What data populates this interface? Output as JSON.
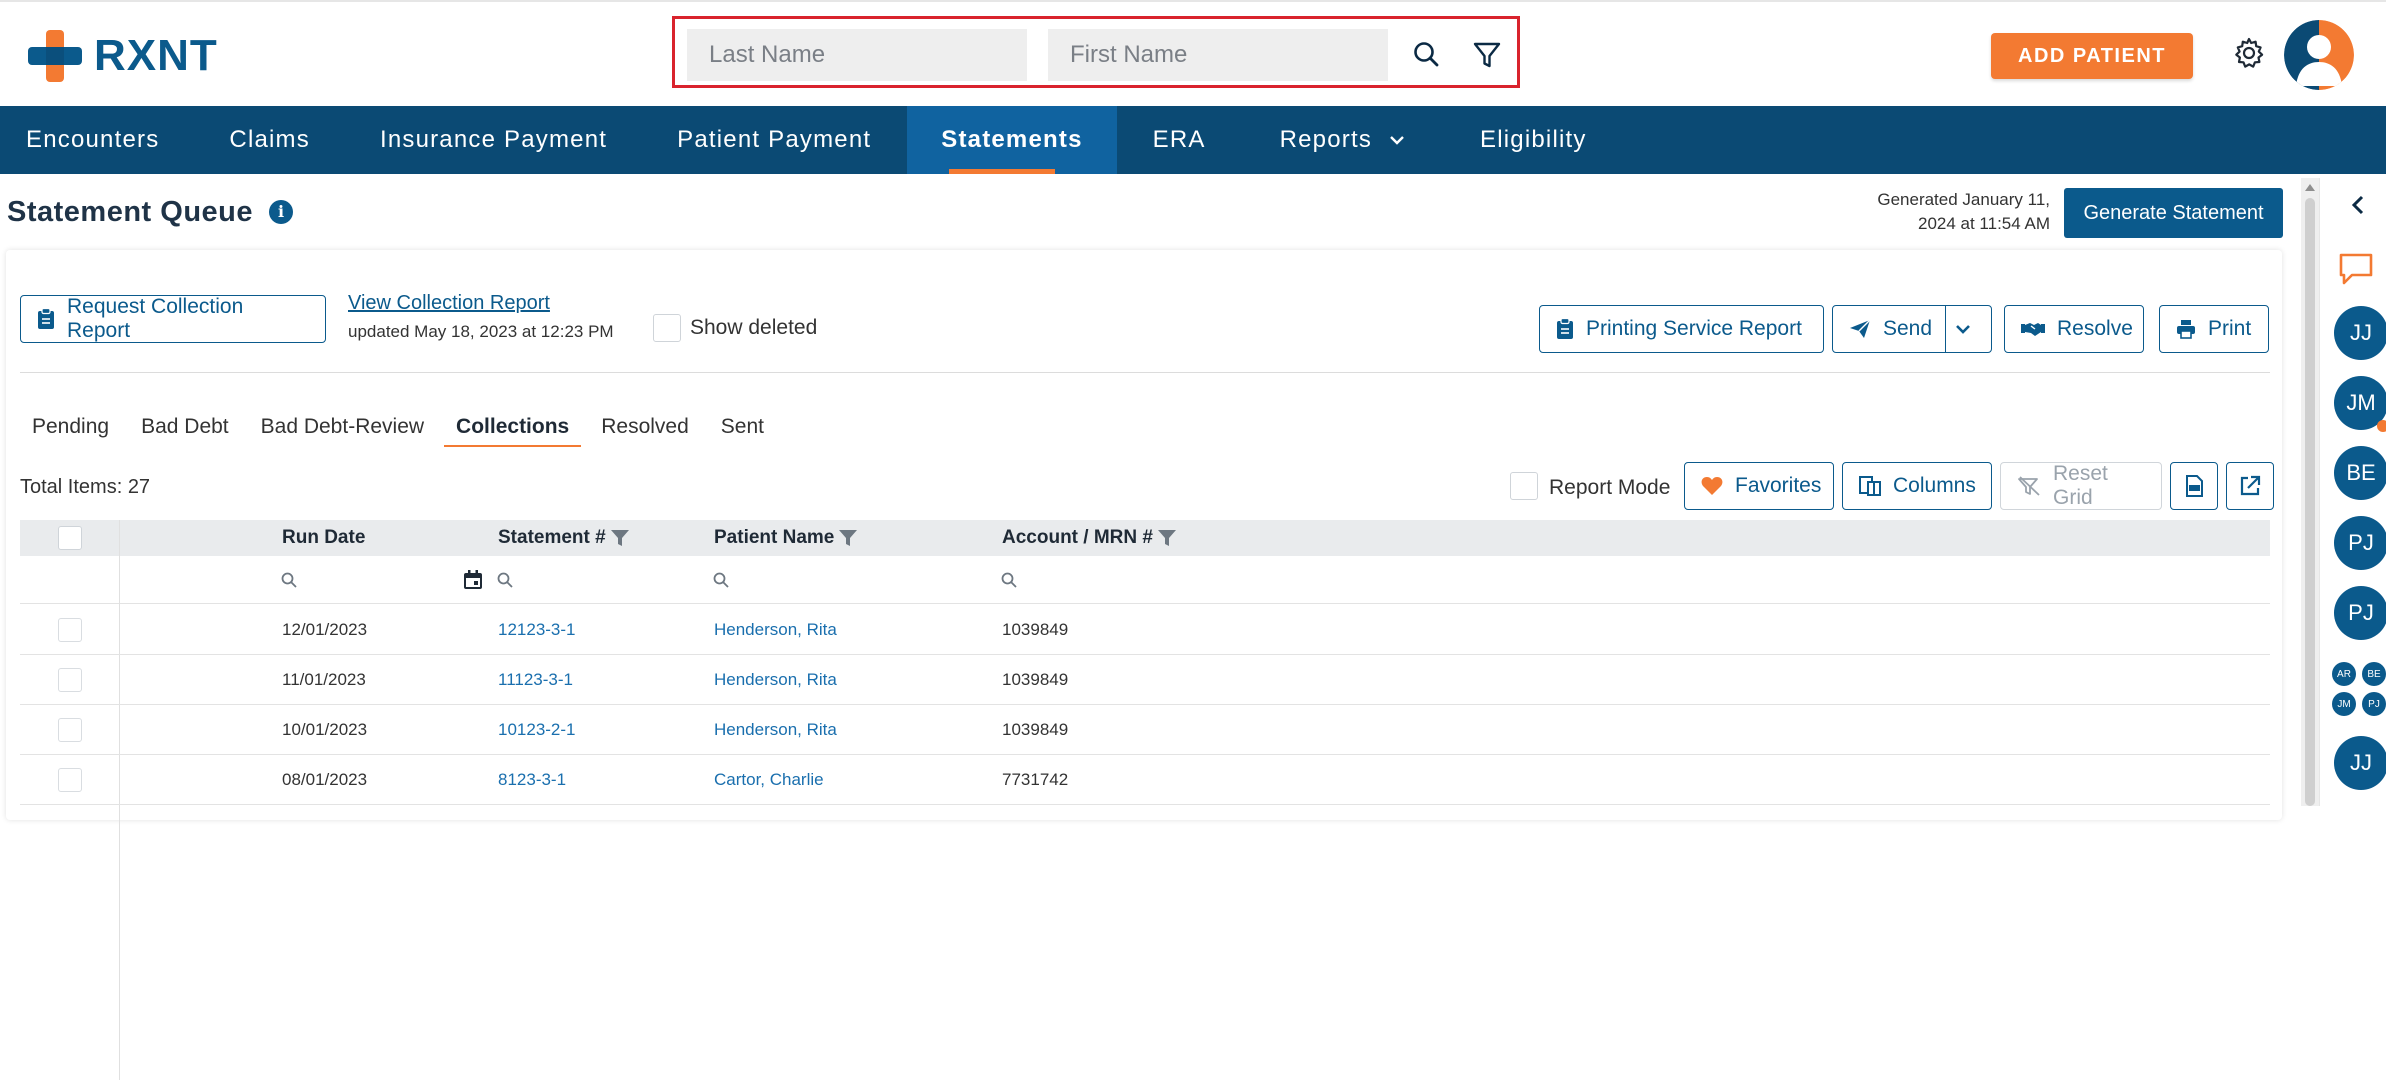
{
  "brand": {
    "name": "RXNT",
    "orange": "#f37a32",
    "navy": "#0b4a74",
    "blue": "#0b5a8c",
    "highlight_border": "#d9232d"
  },
  "header": {
    "search": {
      "last_name_placeholder": "Last Name",
      "first_name_placeholder": "First Name",
      "search_icon": "search-icon",
      "filter_icon": "filter-icon"
    },
    "add_patient_label": "ADD PATIENT",
    "settings_icon": "gear-icon",
    "avatar_icon": "user-avatar-icon"
  },
  "nav": {
    "items": [
      {
        "label": "Encounters"
      },
      {
        "label": "Claims"
      },
      {
        "label": "Insurance Payment"
      },
      {
        "label": "Patient Payment"
      },
      {
        "label": "Statements",
        "active": true
      },
      {
        "label": "ERA"
      },
      {
        "label": "Reports",
        "has_dropdown": true
      },
      {
        "label": "Eligibility"
      }
    ]
  },
  "page": {
    "title": "Statement Queue",
    "info_icon": "info-icon",
    "generated_text": "Generated January 11, 2024 at 11:54 AM",
    "generate_button": "Generate Statement"
  },
  "toolbar": {
    "request_collection_report": "Request Collection Report",
    "view_collection_report": "View Collection Report",
    "updated_text": "updated May 18, 2023 at 12:23 PM",
    "show_deleted": "Show deleted",
    "printing_service_report": "Printing Service Report",
    "send": "Send",
    "resolve": "Resolve",
    "print": "Print"
  },
  "tabs": [
    {
      "label": "Pending"
    },
    {
      "label": "Bad Debt"
    },
    {
      "label": "Bad Debt-Review"
    },
    {
      "label": "Collections",
      "active": true
    },
    {
      "label": "Resolved"
    },
    {
      "label": "Sent"
    }
  ],
  "grid_toolbar": {
    "total_items": "Total Items: 27",
    "report_mode": "Report Mode",
    "favorites": "Favorites",
    "columns": "Columns",
    "reset_grid": "Reset Grid"
  },
  "grid": {
    "columns": [
      "Run Date",
      "Statement #",
      "Patient Name",
      "Account / MRN #"
    ],
    "rows": [
      {
        "run_date": "12/01/2023",
        "statement": "12123-3-1",
        "patient": "Henderson, Rita",
        "account": "1039849"
      },
      {
        "run_date": "11/01/2023",
        "statement": "11123-3-1",
        "patient": "Henderson, Rita",
        "account": "1039849"
      },
      {
        "run_date": "10/01/2023",
        "statement": "10123-2-1",
        "patient": "Henderson, Rita",
        "account": "1039849"
      },
      {
        "run_date": "08/01/2023",
        "statement": "8123-3-1",
        "patient": "Cartor, Charlie",
        "account": "7731742"
      }
    ]
  },
  "rail": {
    "collapse_icon": "chevron-left-icon",
    "chat_icon": "chat-icon",
    "contacts": [
      {
        "initials": "JJ"
      },
      {
        "initials": "JM"
      },
      {
        "initials": "BE"
      },
      {
        "initials": "PJ"
      },
      {
        "initials": "PJ"
      }
    ],
    "group": [
      "AR",
      "BE",
      "JM",
      "PJ"
    ],
    "last_contact": "JJ"
  }
}
